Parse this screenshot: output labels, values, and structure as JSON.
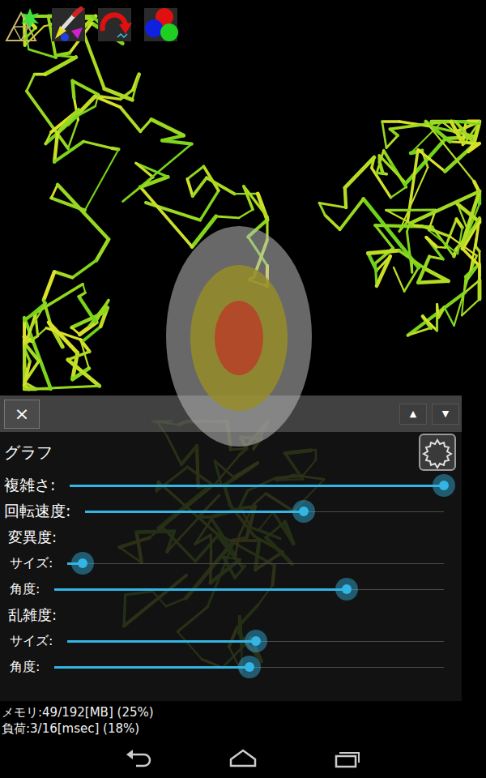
{
  "panel": {
    "close_button": "×",
    "scroll_up": "▲",
    "scroll_down": "▼",
    "title": "グラフ",
    "rows": [
      {
        "kind": "slider",
        "label": "複雑さ:",
        "level": 1.0
      },
      {
        "kind": "slider",
        "label": "回転速度:",
        "level": 0.61
      },
      {
        "kind": "group",
        "label": "変異度:"
      },
      {
        "kind": "subslider",
        "label": "サイズ:",
        "level": 0.04
      },
      {
        "kind": "subslider",
        "label": "角度:",
        "level": 0.75
      },
      {
        "kind": "group",
        "label": "乱雑度:"
      },
      {
        "kind": "subslider",
        "label": "サイズ:",
        "level": 0.5
      },
      {
        "kind": "subslider",
        "label": "角度:",
        "level": 0.5
      }
    ]
  },
  "status_bar": [
    "メモリ:49/192[MB] (25%)",
    "負荷:3/16[msec] (18%)"
  ]
}
